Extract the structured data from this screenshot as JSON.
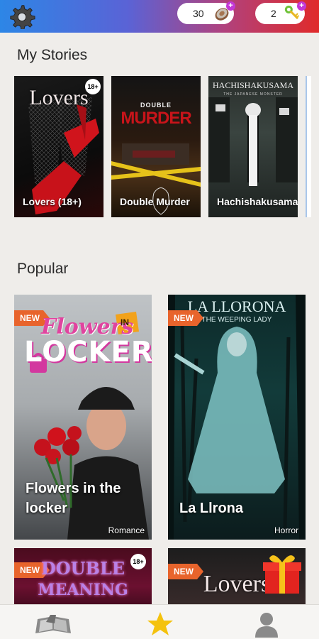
{
  "header": {
    "coins": "30",
    "keys": "2",
    "plus_symbol": "+"
  },
  "my_stories": {
    "title": "My Stories",
    "items": [
      {
        "label": "Lovers (18+)",
        "cover_text": "Lovers",
        "badge": "18+"
      },
      {
        "label": "Double Murder",
        "cover_text_top": "DOUBLE",
        "cover_text_main": "MURDER"
      },
      {
        "label": "Hachishakusama",
        "cover_text": "HACHISHAKUSAMA",
        "cover_subtext": "THE JAPANESE MONSTER"
      }
    ]
  },
  "popular": {
    "title": "Popular",
    "items": [
      {
        "new_tag": "NEW",
        "cover_line1": "Flowers",
        "cover_in": "IN",
        "cover_line2": "LOCKER",
        "name": "Flowers in the locker",
        "genre": "Romance"
      },
      {
        "new_tag": "NEW",
        "cover_title": "LA LLORONA",
        "cover_subtitle": "THE WEEPING LADY",
        "name": "La Llrona",
        "genre": "Horror"
      },
      {
        "new_tag": "NEW",
        "cover_line1": "DOUBLE",
        "cover_line2": "MEANING",
        "badge": "18+"
      },
      {
        "new_tag": "NEW",
        "cover_title": "Lovers"
      }
    ]
  },
  "nav": {
    "items": [
      {
        "icon": "library-icon"
      },
      {
        "icon": "star-icon",
        "active": true
      },
      {
        "icon": "profile-icon"
      }
    ]
  },
  "colors": {
    "accent_star": "#f4c20d",
    "new_tag": "#e8642c"
  }
}
